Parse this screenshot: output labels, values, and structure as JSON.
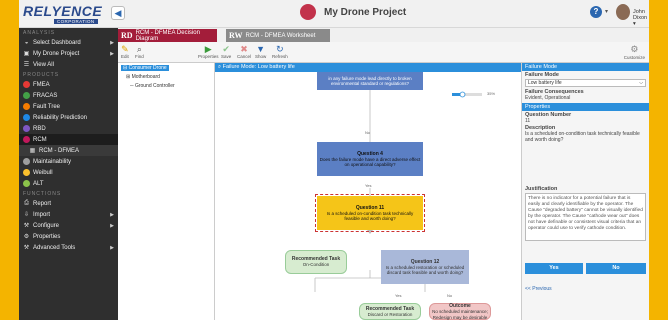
{
  "app": {
    "logo_text": "RELYENCE",
    "logo_sub": "CORPORATION",
    "project_title": "My Drone Project",
    "user_name": "John Dixon"
  },
  "sidebar": {
    "sections": [
      "ANALYSIS",
      "PRODUCTS",
      "FUNCTIONS"
    ],
    "analysis_items": [
      {
        "label": "Select Dashboard",
        "icon": "dashboard-icon"
      },
      {
        "label": "My Drone Project",
        "icon": "folder-icon"
      },
      {
        "label": "View All",
        "icon": "list-icon"
      }
    ],
    "product_items": [
      {
        "label": "FMEA",
        "color": "#e53935"
      },
      {
        "label": "FRACAS",
        "color": "#43a047"
      },
      {
        "label": "Fault Tree",
        "color": "#f57c00"
      },
      {
        "label": "Reliability Prediction",
        "color": "#1e88e5"
      },
      {
        "label": "RBD",
        "color": "#7e57c2"
      },
      {
        "label": "RCM",
        "color": "#c2185b"
      },
      {
        "label": "RCM - DFMEA",
        "color": "#ffffff"
      },
      {
        "label": "Maintainability",
        "color": "#9e9e9e"
      },
      {
        "label": "Weibull",
        "color": "#fbc02d"
      },
      {
        "label": "ALT",
        "color": "#8bc34a"
      }
    ],
    "function_items": [
      {
        "label": "Report",
        "icon": "printer-icon"
      },
      {
        "label": "Import",
        "icon": "import-icon"
      },
      {
        "label": "Configure",
        "icon": "wrench-icon"
      },
      {
        "label": "Properties",
        "icon": "gear-icon"
      },
      {
        "label": "Advanced Tools",
        "icon": "tools-icon"
      }
    ]
  },
  "tabs": [
    {
      "abbr": "RD",
      "label": "RCM - DFMEA Decision Diagram",
      "color": "#a31d3a"
    },
    {
      "abbr": "RW",
      "label": "RCM - DFMEA Worksheet",
      "color": "#8a8a8a"
    }
  ],
  "toolbar": {
    "edit": "Edit",
    "find": "Find",
    "properties": "Properties",
    "save": "Save",
    "cancel": "Cancel",
    "show": "Show",
    "refresh": "Refresh",
    "customize": "Customize"
  },
  "tree": {
    "root": "Consumer Drone",
    "children": [
      "Motherboard",
      "Ground Controller"
    ]
  },
  "diagram": {
    "header": "Failure Mode: Low battery life",
    "zoom": "35%",
    "top_text": "in any failure mode lead directly to broken environmental standard or regulations?",
    "edge_no1": "No",
    "q4_title": "Question 4",
    "q4_text": "Does the failure mode have a direct adverse effect on operational capability?",
    "edge_yes1": "Yes",
    "q11_title": "Question 11",
    "q11_text": "Is a scheduled on-condition task technically feasible and worth doing?",
    "edge_yes2": "Yes",
    "edge_no2": "No",
    "rec1_title": "Recommended Task",
    "rec1_text": "On-Condition",
    "q12_title": "Question 12",
    "q12_text": "Is a scheduled restoration or scheduled discard task feasible and worth doing?",
    "edge_yes3": "Yes",
    "edge_no3": "No",
    "rec2_title": "Recommended Task",
    "rec2_text": "Discard or Restoration",
    "out_title": "Outcome",
    "out_text": "No scheduled maintenance; Redesign may be desirable"
  },
  "panel": {
    "header": "Failure Mode",
    "fm_label": "Failure Mode",
    "fm_value": "Low battery life",
    "fc_label": "Failure Consequences",
    "fc_value": "Evident, Operational",
    "props_header": "Properties",
    "qn_label": "Question Number",
    "qn_value": "11",
    "desc_label": "Description",
    "desc_value": "Is a scheduled on-condition task technically feasible and worth doing?",
    "just_label": "Justification",
    "just_value": "There is no indicator for a potential failure that is easily and clearly identifiable by the operator. The Cause \"degraded battery\" cannot be visually identified by the operator. The Cause \"cathode wear out\" does not have definable or consistent visual criteria that an operator could use to verify cathode condition.",
    "yes": "Yes",
    "no": "No",
    "previous": "<< Previous"
  }
}
